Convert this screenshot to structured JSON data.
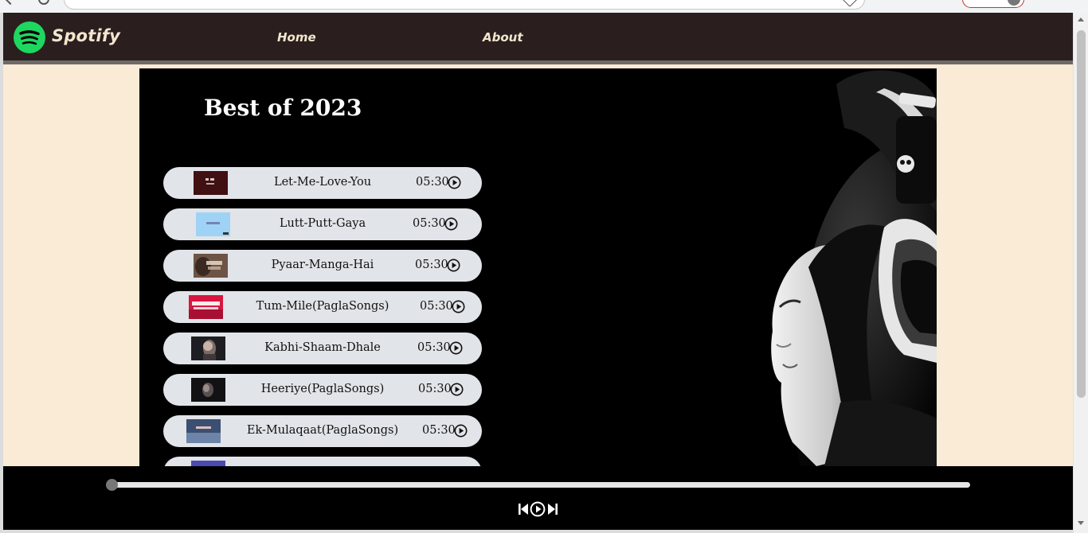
{
  "brand": {
    "name": "Spotify",
    "color": "#1ed760"
  },
  "nav": {
    "home": "Home",
    "about": "About"
  },
  "playlist": {
    "title": "Best of 2023",
    "songs": [
      {
        "name": "Let-Me-Love-You",
        "duration": "05:30"
      },
      {
        "name": "Lutt-Putt-Gaya",
        "duration": "05:30"
      },
      {
        "name": "Pyaar-Manga-Hai",
        "duration": "05:30"
      },
      {
        "name": "Tum-Mile(PaglaSongs)",
        "duration": "05:30"
      },
      {
        "name": "Kabhi-Shaam-Dhale",
        "duration": "05:30"
      },
      {
        "name": "Heeriye(PaglaSongs)",
        "duration": "05:30"
      },
      {
        "name": "Ek-Mulaqaat(PaglaSongs)",
        "duration": "05:30"
      }
    ]
  },
  "player": {
    "progress": 0
  },
  "colors": {
    "navbar": "#2a1f1e",
    "page": "#faebd7",
    "nav_text": "#f3e6cf",
    "song_bg": "#e1e4e8"
  }
}
